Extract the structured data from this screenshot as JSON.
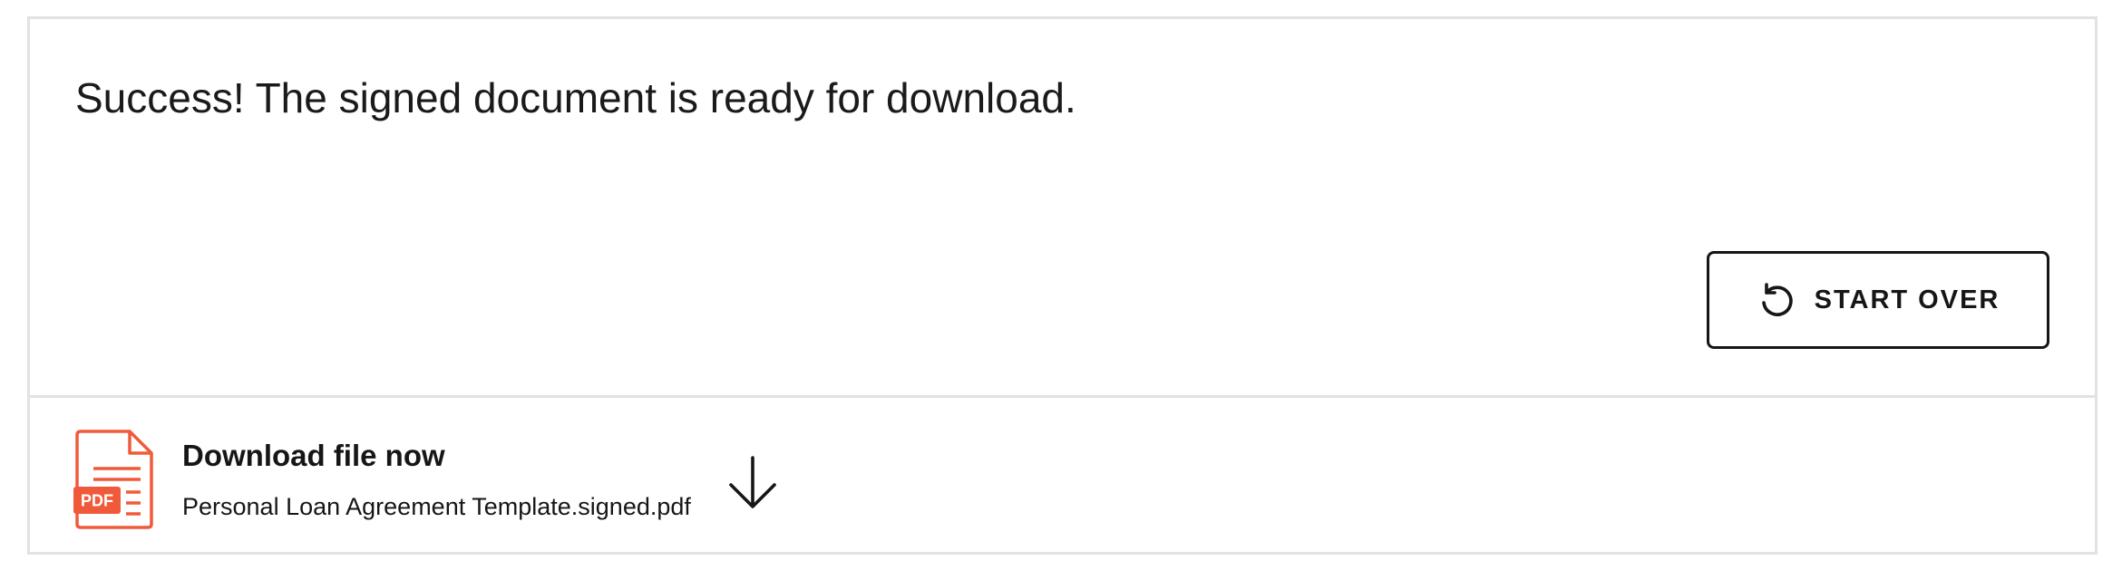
{
  "message": {
    "text": "Success! The signed document is ready for download."
  },
  "actions": {
    "start_over": {
      "label": "START OVER",
      "icon": "restart-icon"
    }
  },
  "download": {
    "title": "Download file now",
    "file_name": "Personal Loan Agreement Template.signed.pdf",
    "file_icon": "pdf-file-icon",
    "file_badge": "PDF",
    "action_icon": "arrow-down-icon"
  },
  "colors": {
    "pdf_accent": "#f05a3a",
    "text": "#161616",
    "border": "#e2e2e2"
  }
}
